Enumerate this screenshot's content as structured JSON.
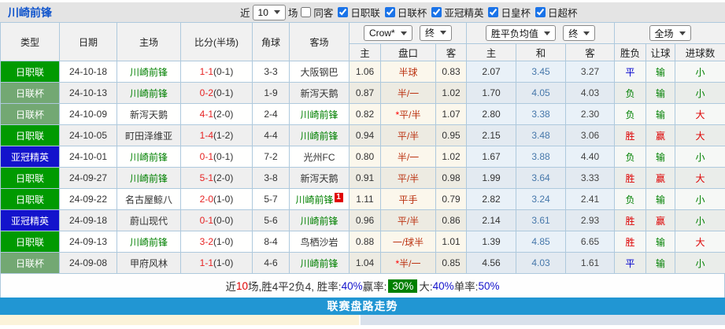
{
  "title": "川崎前锋",
  "controls": {
    "recent_label": "近",
    "recent_select": "10",
    "games_label": "场",
    "same_away": {
      "label": "同客",
      "checked": false
    },
    "leagues": [
      {
        "label": "日职联",
        "checked": true
      },
      {
        "label": "日联杯",
        "checked": true
      },
      {
        "label": "亚冠精英",
        "checked": true
      },
      {
        "label": "日皇杯",
        "checked": true
      },
      {
        "label": "日超杯",
        "checked": true
      }
    ]
  },
  "table": {
    "selects": {
      "odds_source": "Crow*",
      "odds_time": "终",
      "avg": "胜平负均值",
      "avg_time": "终",
      "scope": "全场"
    },
    "headers": {
      "left": [
        "类型",
        "日期",
        "主场",
        "比分(半场)",
        "角球",
        "客场"
      ],
      "odds": [
        "主",
        "盘口",
        "客"
      ],
      "avg": [
        "主",
        "和",
        "客"
      ],
      "result": [
        "胜负",
        "让球",
        "进球数"
      ]
    },
    "type_color_map": {
      "日职联": "#019a01",
      "日联杯": "#73a873",
      "亚冠精英": "#1313cc"
    },
    "result_color_map": {
      "胜": "#dd0000",
      "平": "#0000cc",
      "负": "#008000",
      "赢": "#dd0000",
      "输": "#008000",
      "大": "#dd0000",
      "小": "#008000"
    },
    "handicap_color": "#bb3311",
    "score_color": "#e62222",
    "self_team_color": "#008000",
    "avg_colors": [
      "#333333",
      "#4677aa",
      "#444444"
    ],
    "rows": [
      {
        "type": "日职联",
        "date": "24-10-18",
        "home": "川崎前锋",
        "home_self": true,
        "score": "1-1",
        "half": "(0-1)",
        "corner": "3-3",
        "away": "大阪钢巴",
        "away_self": false,
        "red_card": false,
        "odds": [
          "1.06",
          "半球",
          "0.83"
        ],
        "avg": [
          "2.07",
          "3.45",
          "3.27"
        ],
        "wdl": "平",
        "hcp": "输",
        "goal": "小"
      },
      {
        "type": "日联杯",
        "date": "24-10-13",
        "home": "川崎前锋",
        "home_self": true,
        "score": "0-2",
        "half": "(0-1)",
        "corner": "1-9",
        "away": "新泻天鹅",
        "away_self": false,
        "red_card": false,
        "odds": [
          "0.87",
          "半/一",
          "1.02"
        ],
        "avg": [
          "1.70",
          "4.05",
          "4.03"
        ],
        "wdl": "负",
        "hcp": "输",
        "goal": "小"
      },
      {
        "type": "日联杯",
        "date": "24-10-09",
        "home": "新泻天鹅",
        "home_self": false,
        "score": "4-1",
        "half": "(2-0)",
        "corner": "2-4",
        "away": "川崎前锋",
        "away_self": true,
        "red_card": false,
        "odds": [
          "0.82",
          "*平/半",
          "1.07"
        ],
        "avg": [
          "2.80",
          "3.38",
          "2.30"
        ],
        "wdl": "负",
        "hcp": "输",
        "goal": "大"
      },
      {
        "type": "日职联",
        "date": "24-10-05",
        "home": "町田泽维亚",
        "home_self": false,
        "score": "1-4",
        "half": "(1-2)",
        "corner": "4-4",
        "away": "川崎前锋",
        "away_self": true,
        "red_card": false,
        "odds": [
          "0.94",
          "平/半",
          "0.95"
        ],
        "avg": [
          "2.15",
          "3.48",
          "3.06"
        ],
        "wdl": "胜",
        "hcp": "赢",
        "goal": "大"
      },
      {
        "type": "亚冠精英",
        "date": "24-10-01",
        "home": "川崎前锋",
        "home_self": true,
        "score": "0-1",
        "half": "(0-1)",
        "corner": "7-2",
        "away": "光州FC",
        "away_self": false,
        "red_card": false,
        "odds": [
          "0.80",
          "半/一",
          "1.02"
        ],
        "avg": [
          "1.67",
          "3.88",
          "4.40"
        ],
        "wdl": "负",
        "hcp": "输",
        "goal": "小"
      },
      {
        "type": "日职联",
        "date": "24-09-27",
        "home": "川崎前锋",
        "home_self": true,
        "score": "5-1",
        "half": "(2-0)",
        "corner": "3-8",
        "away": "新泻天鹅",
        "away_self": false,
        "red_card": false,
        "odds": [
          "0.91",
          "平/半",
          "0.98"
        ],
        "avg": [
          "1.99",
          "3.64",
          "3.33"
        ],
        "wdl": "胜",
        "hcp": "赢",
        "goal": "大"
      },
      {
        "type": "日职联",
        "date": "24-09-22",
        "home": "名古屋鲸八",
        "home_self": false,
        "score": "2-0",
        "half": "(1-0)",
        "corner": "5-7",
        "away": "川崎前锋",
        "away_self": true,
        "red_card": true,
        "red_card_text": "1",
        "odds": [
          "1.11",
          "平手",
          "0.79"
        ],
        "avg": [
          "2.82",
          "3.24",
          "2.41"
        ],
        "wdl": "负",
        "hcp": "输",
        "goal": "小"
      },
      {
        "type": "亚冠精英",
        "date": "24-09-18",
        "home": "蔚山现代",
        "home_self": false,
        "score": "0-1",
        "half": "(0-0)",
        "corner": "5-6",
        "away": "川崎前锋",
        "away_self": true,
        "red_card": false,
        "odds": [
          "0.96",
          "平/半",
          "0.86"
        ],
        "avg": [
          "2.14",
          "3.61",
          "2.93"
        ],
        "wdl": "胜",
        "hcp": "赢",
        "goal": "小"
      },
      {
        "type": "日职联",
        "date": "24-09-13",
        "home": "川崎前锋",
        "home_self": true,
        "score": "3-2",
        "half": "(1-0)",
        "corner": "8-4",
        "away": "鸟栖沙岩",
        "away_self": false,
        "red_card": false,
        "odds": [
          "0.88",
          "一/球半",
          "1.01"
        ],
        "avg": [
          "1.39",
          "4.85",
          "6.65"
        ],
        "wdl": "胜",
        "hcp": "输",
        "goal": "大"
      },
      {
        "type": "日联杯",
        "date": "24-09-08",
        "home": "甲府风林",
        "home_self": false,
        "score": "1-1",
        "half": "(1-0)",
        "corner": "4-6",
        "away": "川崎前锋",
        "away_self": true,
        "red_card": false,
        "odds": [
          "1.04",
          "*半/一",
          "0.85"
        ],
        "avg": [
          "4.56",
          "4.03",
          "1.61"
        ],
        "wdl": "平",
        "hcp": "输",
        "goal": "小"
      }
    ]
  },
  "summary": {
    "segments": [
      {
        "text": "近",
        "style": "plain"
      },
      {
        "text": "10",
        "style": "red"
      },
      {
        "text": "场,胜4平2负4, 胜率:",
        "style": "plain"
      },
      {
        "text": "40%",
        "style": "pct"
      },
      {
        "text": " 赢率:",
        "style": "plain"
      },
      {
        "text": "30%",
        "style": "hl"
      },
      {
        "text": " 大:",
        "style": "plain"
      },
      {
        "text": "40%",
        "style": "pct"
      },
      {
        "text": " 单率:",
        "style": "plain"
      },
      {
        "text": "50%",
        "style": "pct"
      }
    ]
  },
  "footer": {
    "label": "联赛盘路走势"
  }
}
